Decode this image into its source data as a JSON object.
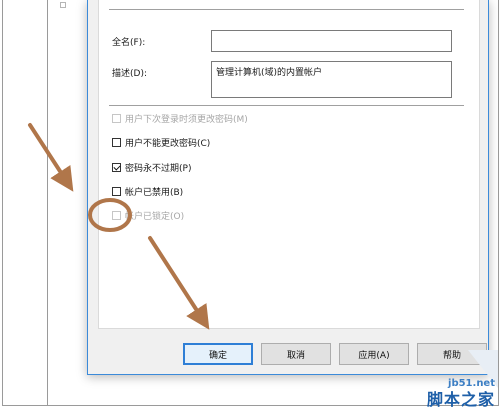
{
  "form": {
    "full_name_label": "全名(F):",
    "full_name_value": "",
    "description_label": "描述(D):",
    "description_value": "管理计算机(域)的内置帐户"
  },
  "checkboxes": [
    {
      "label": "用户下次登录时须更改密码(M)",
      "checked": false,
      "enabled": false
    },
    {
      "label": "用户不能更改密码(C)",
      "checked": false,
      "enabled": true
    },
    {
      "label": "密码永不过期(P)",
      "checked": true,
      "enabled": true
    },
    {
      "label": "帐户已禁用(B)",
      "checked": false,
      "enabled": true
    },
    {
      "label": "帐户已锁定(O)",
      "checked": false,
      "enabled": false
    }
  ],
  "buttons": {
    "ok": "确定",
    "cancel": "取消",
    "apply": "应用(A)",
    "help": "帮助"
  },
  "watermark": {
    "domain": "jb51.net",
    "name": "脚本之家"
  },
  "colors": {
    "annotation": "#b0764a",
    "accent": "#2f7fd6"
  }
}
